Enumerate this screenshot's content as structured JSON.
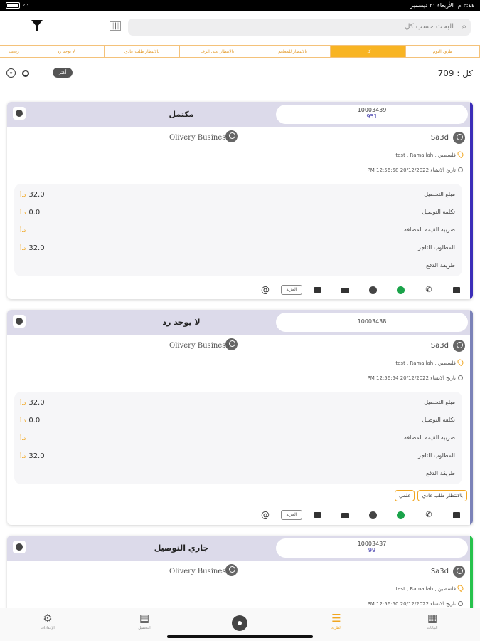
{
  "status_bar": {
    "time": "٣:٤٤ م",
    "date": "الأربعاء ٢١ ديسمبر"
  },
  "search": {
    "placeholder": "البحث حسب كل"
  },
  "tabs": [
    {
      "label": "رفعت",
      "active": false
    },
    {
      "label": "لا يوجد رد",
      "active": false
    },
    {
      "label": "بالانتظار طلب عادي",
      "active": false
    },
    {
      "label": "بالانتظار على الرف",
      "active": false
    },
    {
      "label": "بالانتظار للمطعم",
      "active": false
    },
    {
      "label": "كل",
      "active": true
    },
    {
      "label": "طرود اليوم",
      "active": false
    }
  ],
  "summary": {
    "count_label": "كل : 709",
    "more_label": "أكثر"
  },
  "labels": {
    "collection_amount": "مبلغ التحصيل",
    "delivery_cost": "تكلفة التوصيل",
    "vat": "ضريبة القيمة المضافة",
    "merchant_due": "المطلوب للتاجر",
    "payment_method": "طريقة الدفع",
    "currency": "د.أ",
    "more": "المزيد"
  },
  "cards": [
    {
      "status": "مكتمل",
      "order_id": "10003439",
      "sub_id": "951",
      "customer": "Sa3d",
      "merchant": "Olivery Business",
      "location": "فلسطين , test , Ramallah",
      "created": "تاريخ الانشاء 20/12/2022 12:56:58 PM",
      "collection": "32.0",
      "delivery": "0.0",
      "vat": "",
      "merchant_due": "32.0",
      "accent": "#3b2db8"
    },
    {
      "status": "لا يوجد رد",
      "order_id": "10003438",
      "sub_id": "",
      "customer": "Sa3d",
      "merchant": "Olivery Business",
      "location": "فلسطين , test , Ramallah",
      "created": "تاريخ الانشاء 20/12/2022 12:56:54 PM",
      "collection": "32.0",
      "delivery": "0.0",
      "vat": "",
      "merchant_due": "32.0",
      "tags": [
        "بالانتظار طلب عادي",
        "علمي"
      ],
      "accent": "#7b82b8"
    },
    {
      "status": "جاري التوصيل",
      "order_id": "10003437",
      "sub_id": "99",
      "customer": "Sa3d",
      "merchant": "Olivery Business",
      "location": "فلسطين , test , Ramallah",
      "created": "تاريخ الانشاء 20/12/2022 12:56:50 PM",
      "accent": "#27c24c"
    }
  ],
  "bottom_nav": [
    {
      "label": "الإعدادات",
      "icon": "gear-icon"
    },
    {
      "label": "التحصيل",
      "icon": "document-icon"
    },
    {
      "label": "الطرود",
      "icon": "list-icon",
      "active": true
    },
    {
      "label": "البيانات",
      "icon": "grid-icon"
    }
  ]
}
